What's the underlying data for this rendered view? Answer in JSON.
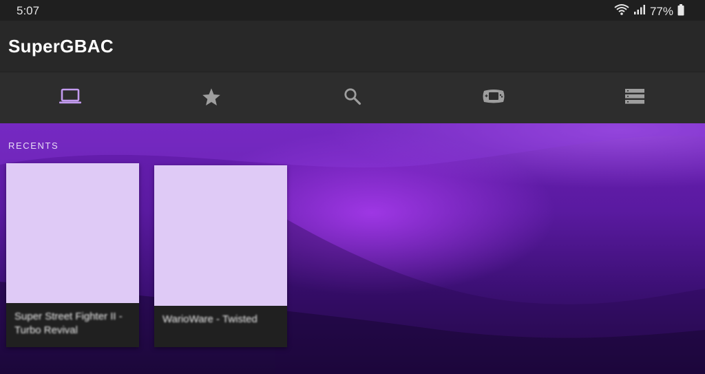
{
  "status_bar": {
    "time": "5:07",
    "battery_percent": "77%",
    "icons": [
      "wifi-icon",
      "signal-icon",
      "battery-icon"
    ]
  },
  "app_bar": {
    "title": "SuperGBAC"
  },
  "tabs": [
    {
      "icon": "laptop-icon",
      "selected": true
    },
    {
      "icon": "star-icon",
      "selected": false
    },
    {
      "icon": "search-icon",
      "selected": false
    },
    {
      "icon": "gameboy-advance-icon",
      "selected": false
    },
    {
      "icon": "list-storage-icon",
      "selected": false
    }
  ],
  "colors": {
    "accent": "#c39bf0",
    "tab_icon": "#9e9e9e",
    "cover_placeholder": "#dfcaf6"
  },
  "recents": {
    "header": "RECENTS",
    "items": [
      {
        "title": "Super Street Fighter II - Turbo Revival"
      },
      {
        "title": "WarioWare - Twisted"
      }
    ]
  }
}
